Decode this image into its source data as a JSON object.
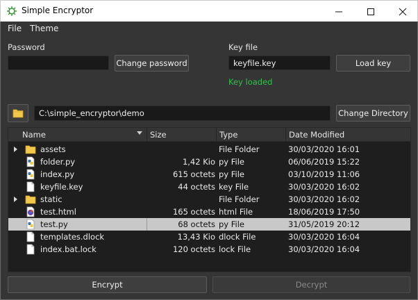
{
  "window": {
    "title": "Simple Encryptor"
  },
  "menu": {
    "items": [
      "File",
      "Theme"
    ]
  },
  "password": {
    "label": "Password",
    "value": "",
    "change_button": "Change password"
  },
  "keyfile": {
    "label": "Key file",
    "value": "keyfile.key",
    "load_button": "Load key",
    "status": "Key loaded"
  },
  "directory": {
    "path": "C:\\simple_encryptor\\demo",
    "change_button": "Change Directory"
  },
  "table": {
    "columns": [
      "Name",
      "Size",
      "Type",
      "Date Modified"
    ],
    "rows": [
      {
        "name": "assets",
        "size": "",
        "type": "File Folder",
        "date": "30/03/2020 16:01",
        "icon": "folder-icon",
        "expandable": true,
        "selected": false
      },
      {
        "name": "folder.py",
        "size": "1,42 Kio",
        "type": "py File",
        "date": "06/06/2019 15:22",
        "icon": "python-file-icon",
        "expandable": false,
        "selected": false
      },
      {
        "name": "index.py",
        "size": "615 octets",
        "type": "py File",
        "date": "03/10/2019 11:06",
        "icon": "python-file-icon",
        "expandable": false,
        "selected": false
      },
      {
        "name": "keyfile.key",
        "size": "44 octets",
        "type": "key File",
        "date": "30/03/2020 16:02",
        "icon": "file-icon",
        "expandable": false,
        "selected": false
      },
      {
        "name": "static",
        "size": "",
        "type": "File Folder",
        "date": "30/03/2020 16:02",
        "icon": "folder-icon",
        "expandable": true,
        "selected": false
      },
      {
        "name": "test.html",
        "size": "165 octets",
        "type": "html File",
        "date": "18/06/2019 17:50",
        "icon": "browser-file-icon",
        "expandable": false,
        "selected": false
      },
      {
        "name": "test.py",
        "size": "68 octets",
        "type": "py File",
        "date": "31/05/2019 20:12",
        "icon": "python-file-icon",
        "expandable": false,
        "selected": true
      },
      {
        "name": "templates.dlock",
        "size": "13,43 Kio",
        "type": "dlock File",
        "date": "30/03/2020 16:04",
        "icon": "file-icon",
        "expandable": false,
        "selected": false
      },
      {
        "name": "index.bat.lock",
        "size": "120 octets",
        "type": "lock File",
        "date": "30/03/2020 16:04",
        "icon": "file-icon",
        "expandable": false,
        "selected": false
      }
    ]
  },
  "actions": {
    "encrypt": "Encrypt",
    "decrypt": "Decrypt",
    "decrypt_enabled": false
  },
  "colors": {
    "background": "#353535",
    "field_bg": "#191919",
    "tree_bg": "#1e1e1e",
    "selection": "#c8c8c8",
    "status_ok": "#2ec24a",
    "folder": "#f2c84b"
  }
}
